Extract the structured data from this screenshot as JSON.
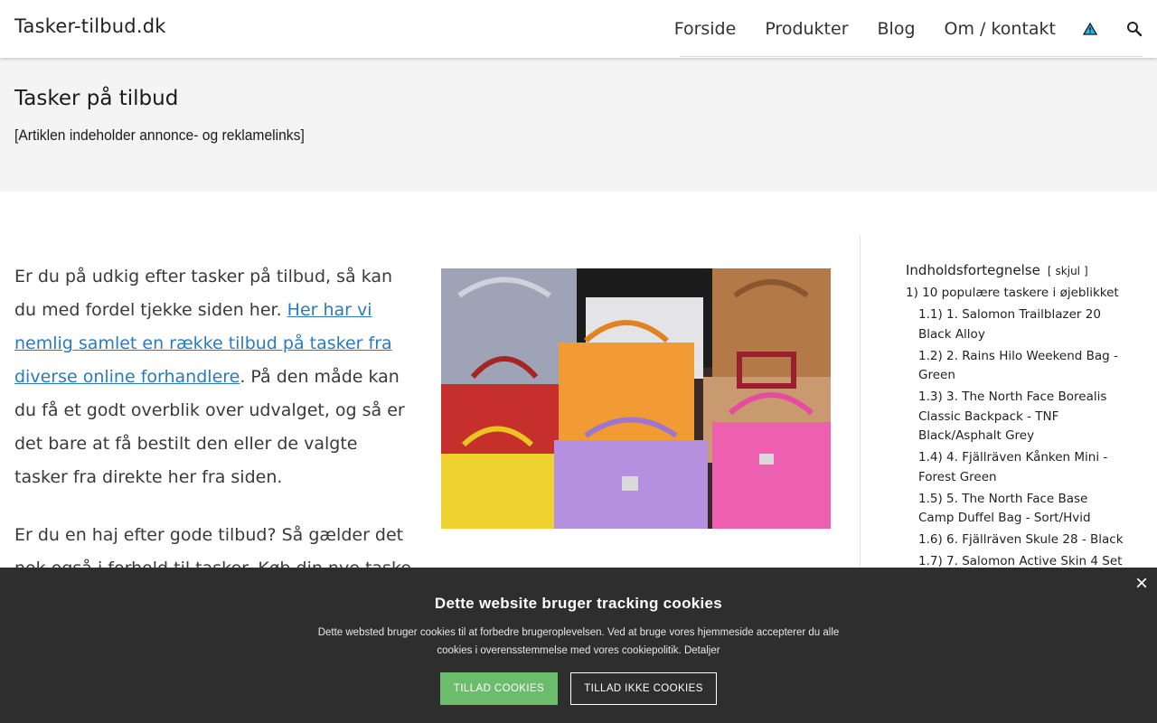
{
  "site": {
    "title": "Tasker-tilbud.dk"
  },
  "nav": {
    "items": [
      "Forside",
      "Produkter",
      "Blog",
      "Om / kontakt"
    ],
    "icons": [
      "warning-icon",
      "search-icon"
    ],
    "warning_color": "#29b6e8"
  },
  "hero": {
    "title": "Tasker på tilbud",
    "disclaimer": "[Artiklen indeholder annonce- og reklamelinks]"
  },
  "article": {
    "p1_text_before": "Er du på udkig efter tasker på tilbud, så kan du med fordel tjekke siden her. ",
    "p1_link": "Her har vi nemlig samlet en række tilbud på tasker fra diverse online forhandlere",
    "p1_text_after": ". På den måde kan du få et godt overblik over udvalget, og så er det bare at få bestilt den eller de valgte tasker fra direkte her fra siden.",
    "p2_text": "Er du en haj efter gode tilbud? Så gælder det nok også i forhold til tasker. Køb din nye taske",
    "link_color": "#2a7bbf"
  },
  "toc": {
    "title": "Indholdsfortegnelse",
    "toggle_open": "[",
    "toggle_label": "skjul",
    "toggle_close": "]",
    "top_item": {
      "num": "1)",
      "label": "10 populære taskere i øjeblikket"
    },
    "sub_items": [
      {
        "num": "1.1)",
        "label": "1. Salomon Trailblazer 20 Black Alloy"
      },
      {
        "num": "1.2)",
        "label": "2. Rains Hilo Weekend Bag - Green"
      },
      {
        "num": "1.3)",
        "label": "3. The North Face Borealis Classic Backpack - TNF Black/Asphalt Grey"
      },
      {
        "num": "1.4)",
        "label": "4. Fjällräven Kånken Mini - Forest Green"
      },
      {
        "num": "1.5)",
        "label": "5. The North Face Base Camp Duffel Bag - Sort/Hvid"
      },
      {
        "num": "1.6)",
        "label": "6. Fjällräven Skule 28 - Black"
      },
      {
        "num": "1.7)",
        "label": "7. Salomon Active Skin 4 Set"
      }
    ]
  },
  "cookie": {
    "title": "Dette website bruger tracking cookies",
    "message": "Dette websted bruger cookies til at forbedre brugeroplevelsen. Ved at bruge vores hjemmeside accepterer du alle cookies i overensstemmelse med vores cookiepolitik. ",
    "details_link": "Detaljer",
    "allow_label": "TILLAD COOKIES",
    "deny_label": "TILLAD IKKE COOKIES",
    "close_label": "×",
    "allow_color": "#6bbd6b",
    "background": "#2e2e2e"
  }
}
